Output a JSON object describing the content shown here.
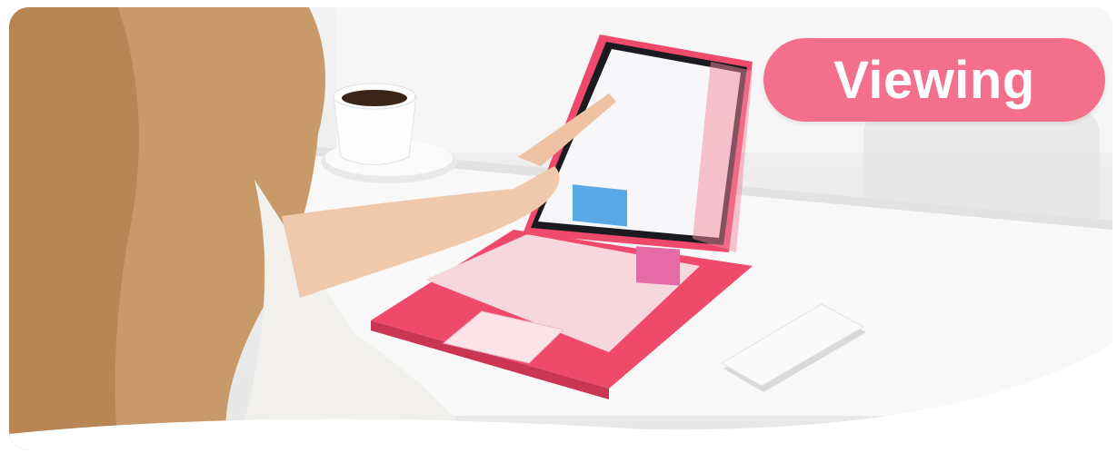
{
  "badge": {
    "label": "Viewing"
  },
  "colors": {
    "badge": "#f46f8b",
    "case": "#ef4a6b",
    "background": "#efefef"
  },
  "icons": [
    "tablet-image",
    "keyboard-image",
    "coffee-cup-image",
    "phone-image"
  ]
}
